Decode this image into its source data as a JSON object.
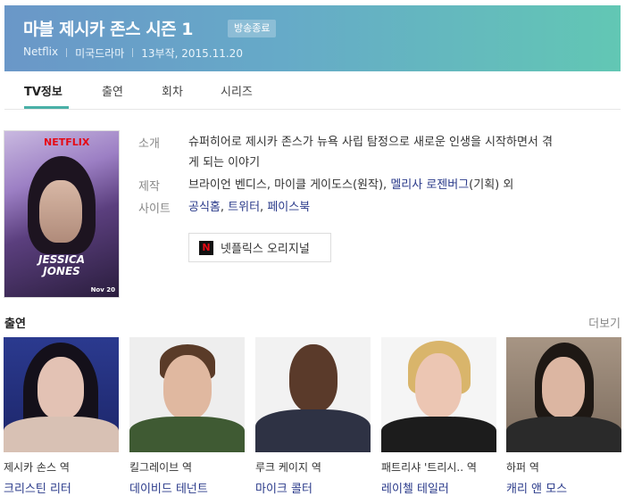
{
  "header": {
    "title": "마블 제시카 존스 시즌 1",
    "badge": "방송종료",
    "meta": [
      "Netflix",
      "미국드라마",
      "13부작, 2015.11.20"
    ]
  },
  "tabs": [
    "TV정보",
    "출연",
    "회차",
    "시리즈"
  ],
  "poster": {
    "brand": "NETFLIX",
    "title_line1": "JESSICA",
    "title_line2": "JONES",
    "date": "Nov 20"
  },
  "info": {
    "intro_label": "소개",
    "intro_line1": "슈퍼히어로 제시카 존스가 뉴욕 사립 탐정으로 새로운 인생을 시작하면서 겪",
    "intro_line2": "게 되는 이야기",
    "production_label": "제작",
    "production_text": "브라이언 벤디스, 마이클 게이도스(원작),",
    "production_link": "멜리사 로젠버그",
    "production_suffix": "(기획) 외",
    "site_label": "사이트",
    "sites": [
      "공식홈",
      "트위터",
      "페이스북"
    ],
    "original_button": "넷플릭스 오리지널",
    "original_icon_letter": "N"
  },
  "cast_section": {
    "title": "출연",
    "more": "더보기",
    "members": [
      {
        "role": "제시카 손스 역",
        "actor": "크리스틴 리터"
      },
      {
        "role": "킬그레이브 역",
        "actor": "데이비드 테넌트"
      },
      {
        "role": "루크 케이지 역",
        "actor": "마이크 콜터"
      },
      {
        "role": "패트리샤 '트리시.. 역",
        "actor": "레이첼 테일러"
      },
      {
        "role": "하퍼 역",
        "actor": "캐리 앤 모스"
      }
    ]
  },
  "colors": {
    "accent": "#49b0a7",
    "link": "#2a3a8a",
    "header_start": "#6a97c8",
    "header_end": "#62c7b4"
  }
}
